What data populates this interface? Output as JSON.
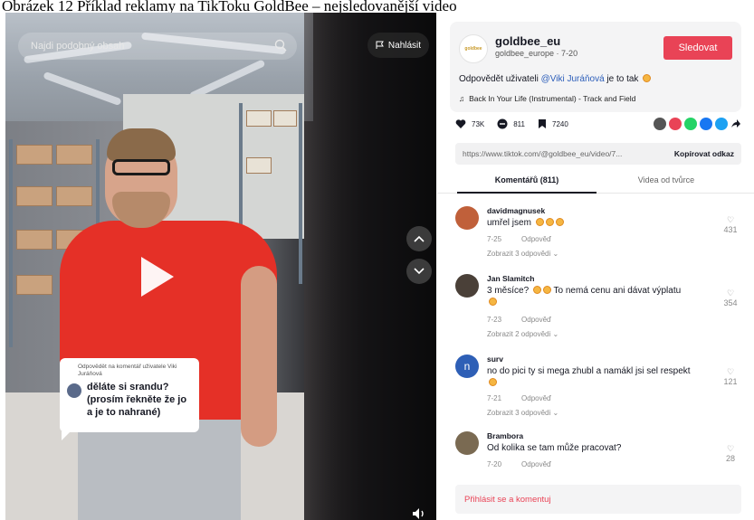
{
  "caption": "Obrázek 12 Příklad reklamy na TikToku GoldBee – nejsledovanější video",
  "video": {
    "search_placeholder": "Najdi podobný obsah",
    "report_label": "Nahlásit",
    "reply_bubble": {
      "small_text": "Odpovědět na komentář uživatele Viki Juráňová",
      "main_text": "děláte si srandu? (prosím řekněte že jo a je to nahrané)"
    }
  },
  "channel": {
    "logo_text": "goldbee",
    "name": "goldbee_eu",
    "handle_date": "goldbee_europe · 7-20",
    "follow_label": "Sledovat",
    "description_prefix": "Odpovědět uživateli ",
    "description_mention": "@Viki Juráňová",
    "description_suffix": " je to tak",
    "music": "Back In Your Life (Instrumental) - Track and Field"
  },
  "stats": {
    "likes": "73K",
    "comments": "811",
    "saves": "7240"
  },
  "share": {
    "url": "https://www.tiktok.com/@goldbee_eu/video/7...",
    "copy_label": "Kopírovat odkaz"
  },
  "tabs": {
    "comments": "Komentářů (811)",
    "creator_videos": "Videa od tvůrce"
  },
  "comments": [
    {
      "user": "davidmagnusek",
      "text": "umřel jsem",
      "emojis": 3,
      "date": "7-25",
      "reply": "Odpověď",
      "more": "Zobrazit 3 odpovědi ⌄",
      "likes": "431",
      "avatar_color": "#c0603a"
    },
    {
      "user": "Jan Slamitch",
      "text": "3 měsíce?",
      "text2": "To nemá cenu ani dávat výplatu",
      "emojis": 2,
      "date": "7-23",
      "reply": "Odpověď",
      "more": "Zobrazit 2 odpovědi ⌄",
      "likes": "354",
      "avatar_color": "#4a4038"
    },
    {
      "user": "surv",
      "text": "no do pici ty si mega zhubl a namákl jsi sel respekt",
      "emojis": 1,
      "date": "7-21",
      "reply": "Odpověď",
      "more": "Zobrazit 3 odpovědi ⌄",
      "likes": "121",
      "avatar_color": "#2e5fb6",
      "avatar_letter": "n"
    },
    {
      "user": "Brambora",
      "text": "Od kolika se tam může pracovat?",
      "emojis": 0,
      "date": "7-20",
      "reply": "Odpověď",
      "more": "",
      "likes": "28",
      "avatar_color": "#7a6a52"
    }
  ],
  "login_prompt": "Přihlásit se a komentuj",
  "colors": {
    "accent_red": "#e94356",
    "mention_blue": "#2b5db9",
    "shirt_red": "#e53027"
  }
}
